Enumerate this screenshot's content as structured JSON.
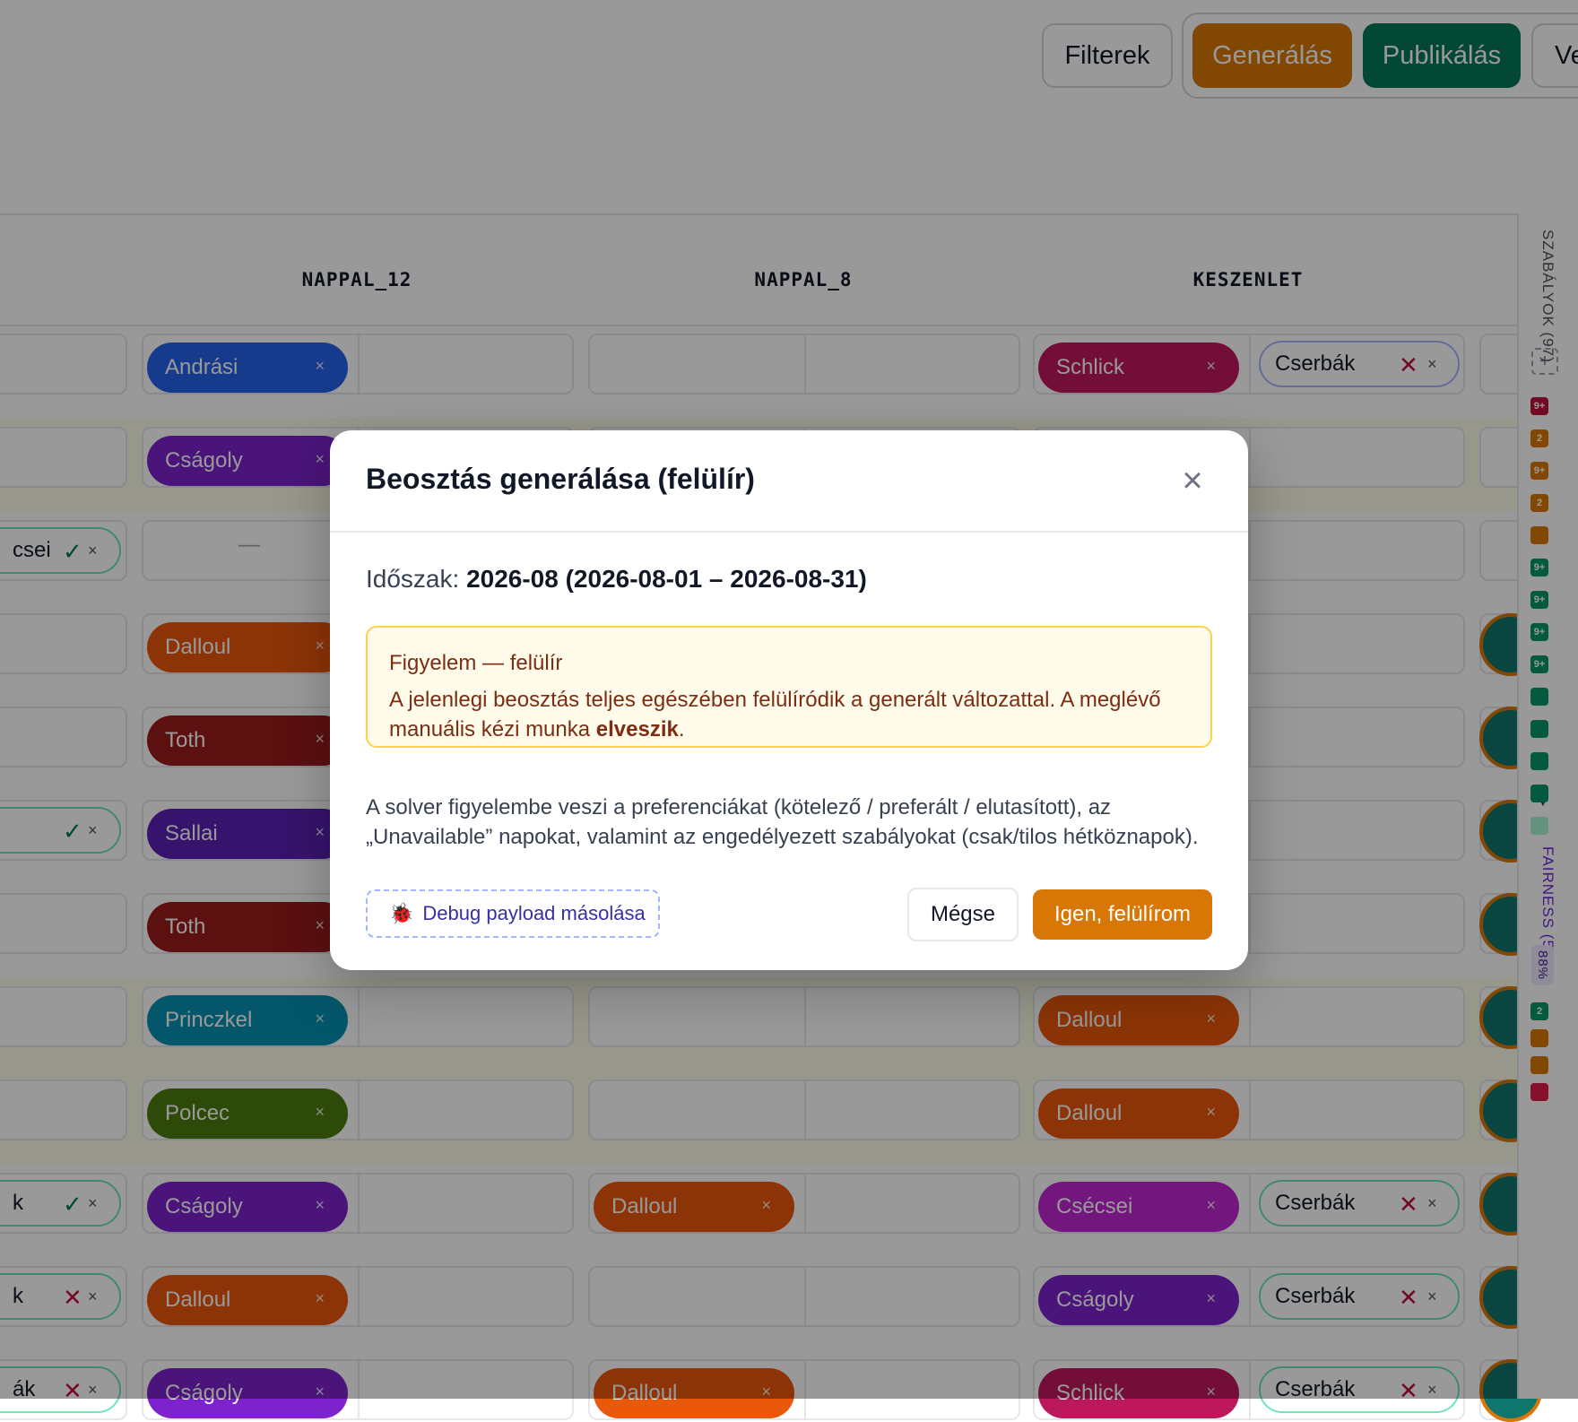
{
  "toolbar": {
    "filters_label": "Filterek",
    "generate_label": "Generálás",
    "publish_label": "Publikálás",
    "partial_label": "Ve"
  },
  "columns": [
    "NAPPAL_12",
    "NAPPAL_8",
    "KESZENLET"
  ],
  "rows": [
    {
      "left": "",
      "left_mark": "",
      "n12": "Andrási",
      "n8": "",
      "k": "Schlick",
      "k2": "Cserbák"
    },
    {
      "left": "",
      "left_mark": "",
      "n12": "Cságoly",
      "n8": "",
      "k": "",
      "k2": ""
    },
    {
      "left": "csei",
      "left_mark": "✓",
      "n12": "—",
      "n8": "",
      "k": "",
      "k2": ""
    },
    {
      "left": "",
      "left_mark": "",
      "n12": "Dalloul",
      "n8": "",
      "k": "",
      "k2": ""
    },
    {
      "left": "",
      "left_mark": "",
      "n12": "Toth",
      "n8": "",
      "k": "",
      "k2": ""
    },
    {
      "left": "",
      "left_mark": "✓",
      "n12": "Sallai",
      "n8": "",
      "k": "",
      "k2": ""
    },
    {
      "left": "",
      "left_mark": "",
      "n12": "Toth",
      "n8": "",
      "k": "",
      "k2": ""
    },
    {
      "left": "",
      "left_mark": "",
      "n12": "Princzkel",
      "n8": "",
      "k": "Dalloul",
      "k2": ""
    },
    {
      "left": "",
      "left_mark": "",
      "n12": "Polcec",
      "n8": "",
      "k": "Dalloul",
      "k2": ""
    },
    {
      "left": "k",
      "left_mark": "✓",
      "n12": "Cságoly",
      "n8": "Dalloul",
      "k": "Csécsei",
      "k2": "Cserbák"
    },
    {
      "left": "k",
      "left_mark": "✕",
      "n12": "Dalloul",
      "n8": "",
      "k": "Cságoly",
      "k2": "Cserbák"
    },
    {
      "left": "ák",
      "left_mark": "✕",
      "n12": "Cságoly",
      "n8": "Dalloul",
      "k": "Schlick",
      "k2": "Cserbák"
    }
  ],
  "chip_remove": "×",
  "mark_reject": "✕",
  "mark_ok": "✓",
  "rail": {
    "rules_label": "SZABÁLYOK (97)",
    "add": "+",
    "fairness_label": "FAIRNESS (5)",
    "fairness_pct": "88%",
    "more": "▼",
    "badges": [
      {
        "t": "9+",
        "c": "#be123c"
      },
      {
        "t": "2",
        "c": "#d97706"
      },
      {
        "t": "9+",
        "c": "#d97706"
      },
      {
        "t": "2",
        "c": "#d97706"
      },
      {
        "t": "",
        "c": "#d97706"
      },
      {
        "t": "9+",
        "c": "#059669"
      },
      {
        "t": "9+",
        "c": "#059669"
      },
      {
        "t": "9+",
        "c": "#059669"
      },
      {
        "t": "9+",
        "c": "#059669"
      },
      {
        "t": "",
        "c": "#059669"
      },
      {
        "t": "",
        "c": "#059669"
      },
      {
        "t": "",
        "c": "#059669"
      },
      {
        "t": "",
        "c": "#059669"
      },
      {
        "t": "",
        "c": "#a7f3d0"
      }
    ],
    "fair_badges": [
      {
        "t": "2",
        "c": "#059669"
      },
      {
        "t": "",
        "c": "#d97706"
      },
      {
        "t": "",
        "c": "#d97706"
      },
      {
        "t": "",
        "c": "#e11d48"
      }
    ]
  },
  "modal": {
    "title": "Beosztás generálása (felülír)",
    "close": "×",
    "period_label": "Időszak:",
    "period_value": "2026-08 (2026-08-01 – 2026-08-31)",
    "warning_title": "Figyelem — felülír",
    "warning_text": "A jelenlegi beosztás teljes egészében felülíródik a generált változattal. A meglévő manuális kézi munka",
    "warning_strong": "elveszik",
    "warning_end": ".",
    "description": "A solver figyelembe veszi a preferenciákat (kötelező / preferált / elutasított), az „Unavailable” napokat, valamint az engedélyezett szabályokat (csak/tilos hétköznapok).",
    "debug_icon": "🐞",
    "debug_label": "Debug payload másolása",
    "cancel_label": "Mégse",
    "confirm_label": "Igen, felülírom"
  },
  "colors": {
    "generate": "#d97706",
    "publish": "#047857",
    "Andrási": "#2563eb",
    "Cságoly": "#7e22ce",
    "Dalloul": "#ea580c",
    "Toth": "#991b1b",
    "Sallai": "#5b21b6",
    "Princzkel": "#0891b2",
    "Polcec": "#4d7c0f",
    "Schlick": "#be185d",
    "Csécsei": "#c026d3"
  }
}
